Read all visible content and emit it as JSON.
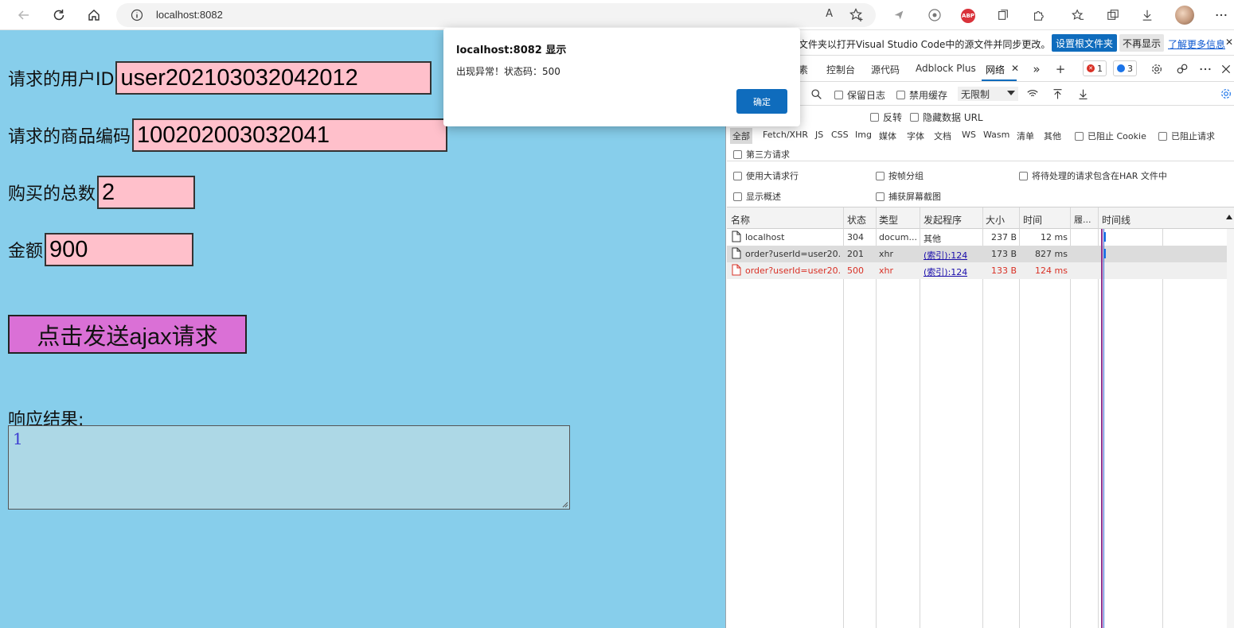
{
  "browser": {
    "url": "localhost:8082",
    "read_aloud": "A",
    "icons": [
      "back-icon",
      "refresh-icon",
      "home-icon",
      "info-icon",
      "favorite-add-icon",
      "extension-icon",
      "abp-icon",
      "collections-icon",
      "puzzle-icon",
      "favorites-icon",
      "tab-actions-icon",
      "download-icon",
      "avatar",
      "more-icon"
    ],
    "abp_label": "ABP"
  },
  "form": {
    "user_id_label": "请求的用户ID",
    "user_id_value": "user202103032042012",
    "product_label": "请求的商品编码",
    "product_value": "100202003032041",
    "count_label": "购买的总数",
    "count_value": "2",
    "amount_label": "金额",
    "amount_value": "900",
    "send_button": "点击发送ajax请求",
    "response_label": "响应结果:",
    "response_value": "1"
  },
  "alert": {
    "title": "localhost:8082 显示",
    "message": "出现异常！状态码：500",
    "ok": "确定"
  },
  "devtools": {
    "notice": {
      "text": "根文件夹以打开Visual Studio Code中的源文件并同步更改。",
      "primary": "设置根文件夹",
      "secondary": "不再显示",
      "link": "了解更多信息",
      "close": "✕"
    },
    "tabs": [
      "素",
      "控制台",
      "源代码",
      "Adblock Plus",
      "网络"
    ],
    "active_tab_close": "✕",
    "more": "»",
    "add": "+",
    "error_count": "1",
    "message_count": "3",
    "toolbar": {
      "preserve_log": "保留日志",
      "disable_cache": "禁用缓存",
      "throttle": "无限制"
    },
    "filters": {
      "invert": "反转",
      "hide_data_url": "隐藏数据 URL",
      "types": [
        "全部",
        "Fetch/XHR",
        "JS",
        "CSS",
        "Img",
        "媒体",
        "字体",
        "文档",
        "WS",
        "Wasm",
        "清单",
        "其他"
      ],
      "blocked_cookies": "已阻止 Cookie",
      "blocked_requests": "已阻止请求",
      "third_party": "第三方请求"
    },
    "options": {
      "large_rows": "使用大请求行",
      "group_by_frame": "按帧分组",
      "har_pending": "将待处理的请求包含在HAR 文件中",
      "overview": "显示概述",
      "screenshots": "捕获屏幕截图"
    },
    "columns": [
      "名称",
      "状态",
      "类型",
      "发起程序",
      "大小",
      "时间",
      "履...",
      "时间线"
    ],
    "rows": [
      {
        "name": "localhost",
        "status": "304",
        "type": "docum...",
        "initiator": "其他",
        "size": "237 B",
        "time": "12 ms",
        "error": false
      },
      {
        "name": "order?userId=user20...",
        "status": "201",
        "type": "xhr",
        "initiator": "(索引):124",
        "size": "173 B",
        "time": "827 ms",
        "error": false
      },
      {
        "name": "order?userId=user20...",
        "status": "500",
        "type": "xhr",
        "initiator": "(索引):124",
        "size": "133 B",
        "time": "124 ms",
        "error": true
      }
    ]
  }
}
